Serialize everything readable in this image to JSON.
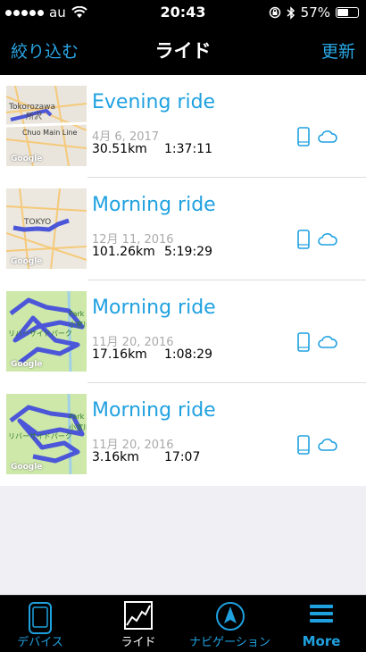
{
  "status": {
    "carrier": "au",
    "time": "20:43",
    "battery_text": "57%",
    "battery_level": 0.57
  },
  "nav": {
    "left_label": "絞り込む",
    "title": "ライド",
    "right_label": "更新"
  },
  "colors": {
    "accent": "#1fa1e0",
    "route": "#4b56d8"
  },
  "rides": [
    {
      "title": "Evening ride",
      "date": "4月 6, 2017",
      "distance": "30.51km",
      "duration": "1:37:11",
      "map_labels": [
        "Tokorozawa",
        "所沢",
        "Chuo Main Line"
      ]
    },
    {
      "title": "Morning ride",
      "date": "12月 11, 2016",
      "distance": "101.26km",
      "duration": "5:19:29",
      "map_labels": [
        "TOKYO"
      ]
    },
    {
      "title": "Morning ride",
      "date": "11月 20, 2016",
      "distance": "17.16km",
      "duration": "1:08:29",
      "map_labels": [
        "Park",
        "小室川",
        "リバーサイドパーク"
      ]
    },
    {
      "title": "Morning ride",
      "date": "11月 20, 2016",
      "distance": "3.16km",
      "duration": "17:07",
      "map_labels": [
        "Park",
        "小室川",
        "リバーサイドパーク"
      ]
    }
  ],
  "map_brand": "Google",
  "tabs": [
    {
      "label": "デバイス",
      "icon": "device-icon",
      "active": false
    },
    {
      "label": "ライド",
      "icon": "ride-chart-icon",
      "active": true
    },
    {
      "label": "ナビゲーション",
      "icon": "navigation-icon",
      "active": false
    },
    {
      "label": "More",
      "icon": "menu-icon",
      "active": false
    }
  ]
}
